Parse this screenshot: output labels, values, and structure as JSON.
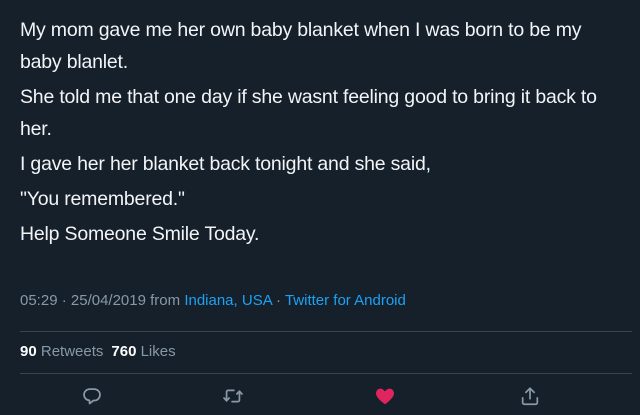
{
  "tweet": {
    "paragraphs": [
      "My mom gave me her own baby blanket when I was born to be my baby blanlet.",
      "She told me that one day if she wasnt feeling good to bring it back to her.",
      "I gave her her blanket back tonight and she said,",
      "\"You remembered.\"",
      "Help Someone Smile Today."
    ],
    "time": "05:29",
    "separator": "·",
    "date": "25/04/2019",
    "from_label": "from",
    "location": "Indiana, USA",
    "client": "Twitter for Android"
  },
  "stats": {
    "retweets_count": "90",
    "retweets_label": "Retweets",
    "likes_count": "760",
    "likes_label": "Likes"
  },
  "actions": {
    "reply_icon": "reply-icon",
    "retweet_icon": "retweet-icon",
    "like_icon": "heart-icon",
    "share_icon": "share-icon"
  },
  "colors": {
    "background": "#15202b",
    "text": "#ffffff",
    "secondary": "#8899a6",
    "link": "#1da1f2",
    "like": "#e0245e",
    "divider": "#38444d"
  }
}
